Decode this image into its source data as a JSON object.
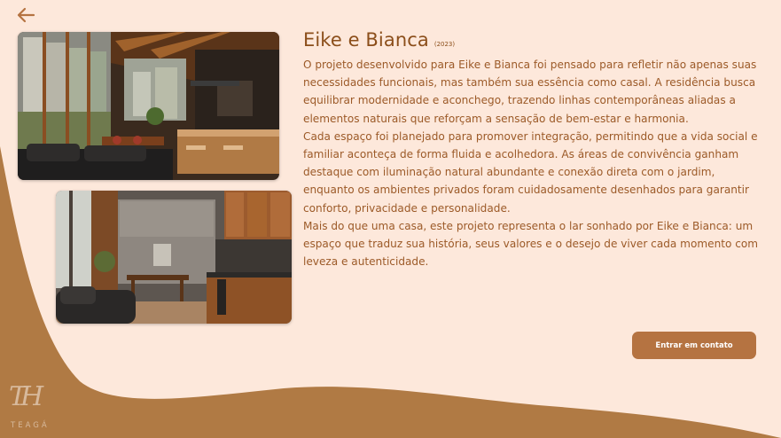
{
  "nav": {
    "back_icon": "arrow-left-icon"
  },
  "project": {
    "name": "Eike e Bianca",
    "year": "(2023)",
    "paragraphs": [
      "O projeto desenvolvido para Eike e Bianca foi pensado para refletir não apenas suas necessidades funcionais, mas também sua essência como casal. A residência busca equilibrar modernidade e aconchego, trazendo linhas contemporâneas aliadas a elementos naturais que reforçam a sensação de bem-estar e harmonia.",
      "Cada espaço foi planejado para promover integração, permitindo que a vida social e familiar aconteça de forma fluida e acolhedora. As áreas de convivência ganham destaque com iluminação natural abundante e conexão direta com o jardim, enquanto os ambientes privados foram cuidadosamente desenhados para garantir conforto, privacidade e personalidade.",
      "Mais do que uma casa, este projeto representa o lar sonhado por Eike e Bianca: um espaço que traduz sua história, seus valores e o desejo de viver cada momento com leveza e autenticidade."
    ]
  },
  "cta": {
    "label": "Entrar em contato"
  },
  "brand": {
    "monogram": "TH",
    "wordmark": "TEAGÁ"
  },
  "colors": {
    "background": "#fde8db",
    "wave": "#b07a44",
    "accent": "#8b4e1a",
    "body_text": "#9c5a28",
    "button": "#b57341"
  }
}
